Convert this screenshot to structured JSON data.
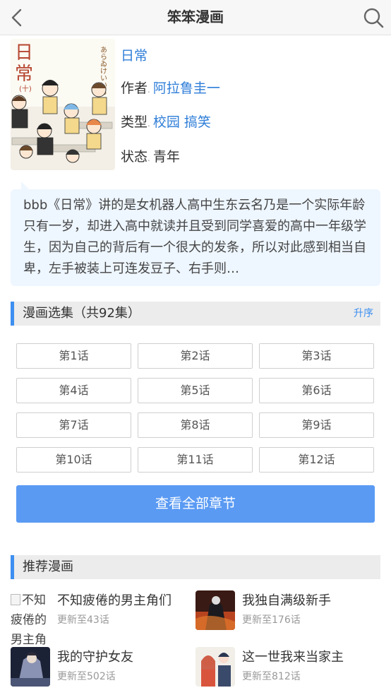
{
  "header": {
    "title": "笨笨漫画",
    "back_icon": "back-arrow-icon",
    "search_icon": "search-icon"
  },
  "comic": {
    "name": "日常",
    "author_label": "作者",
    "author": "阿拉鲁圭一",
    "type_label": "类型",
    "types": [
      "校园",
      "搞笑"
    ],
    "status_label": "状态",
    "status": "青年",
    "cover_title": "日常",
    "cover_volume": "(十)",
    "cover_author_vertical": "あらゐけいいち",
    "description": "bbb《日常》讲的是女机器人高中生东云名乃是一个实际年龄只有一岁，却进入高中就读并且受到同学喜爱的高中一年级学生，因为自己的背后有一个很大的发条，所以对此感到相当自卑，左手被装上可连发豆子、右手则…"
  },
  "chapters_section": {
    "title": "漫画选集（共92集）",
    "order_label": "升序",
    "chapters": [
      "第1话",
      "第2话",
      "第3话",
      "第4话",
      "第5话",
      "第6话",
      "第7话",
      "第8话",
      "第9话",
      "第10话",
      "第11话",
      "第12话"
    ],
    "view_all_label": "查看全部章节"
  },
  "recommend_section": {
    "title": "推荐漫画",
    "items": [
      {
        "title": "不知疲倦的男主角们",
        "update": "更新至43话",
        "thumb_alt": "不知疲倦的男主角们",
        "thumb_broken": true
      },
      {
        "title": "我独自满级新手",
        "update": "更新至176话",
        "thumb_broken": false
      },
      {
        "title": "我的守护女友",
        "update": "更新至502话",
        "thumb_broken": false
      },
      {
        "title": "这一世我来当家主",
        "update": "更新至812话",
        "thumb_broken": false
      }
    ]
  },
  "colors": {
    "accent": "#3d8ff0",
    "link": "#2f7ed8",
    "button": "#5a9af3",
    "desc_bg": "#eef6ff"
  }
}
